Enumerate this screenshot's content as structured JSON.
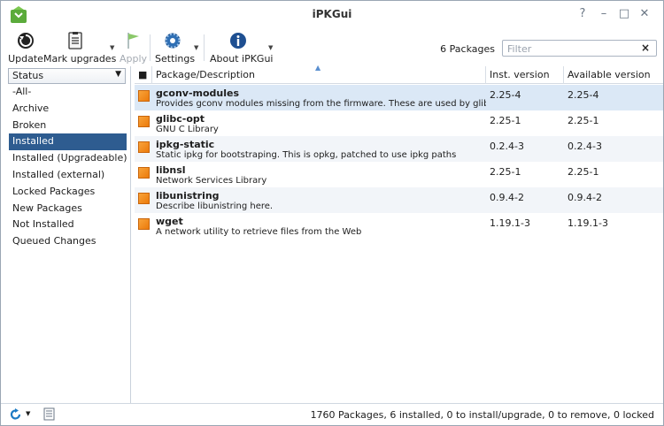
{
  "window": {
    "title": "iPKGui"
  },
  "toolbar": {
    "update_label": "Update",
    "mark_upgrades_label": "Mark upgrades",
    "apply_label": "Apply",
    "settings_label": "Settings",
    "about_label": "About iPKGui",
    "package_count": "6 Packages",
    "filter_placeholder": "Filter",
    "filter_clear": "×"
  },
  "sidebar": {
    "selector_value": "Status",
    "items": [
      {
        "label": "-All-"
      },
      {
        "label": "Archive"
      },
      {
        "label": "Broken"
      },
      {
        "label": "Installed",
        "selected": true
      },
      {
        "label": "Installed (Upgradeable)"
      },
      {
        "label": "Installed (external)"
      },
      {
        "label": "Locked Packages"
      },
      {
        "label": "New Packages"
      },
      {
        "label": "Not Installed"
      },
      {
        "label": "Queued Changes"
      }
    ]
  },
  "table": {
    "columns": [
      "Package/Description",
      "Inst. version",
      "Available version"
    ],
    "rows": [
      {
        "name": "gconv-modules",
        "desc": "Provides gconv modules missing from the firmware. These are used by glibc ico",
        "inst": "2.25-4",
        "avail": "2.25-4"
      },
      {
        "name": "glibc-opt",
        "desc": "GNU C Library",
        "inst": "2.25-1",
        "avail": "2.25-1"
      },
      {
        "name": "ipkg-static",
        "desc": "Static ipkg for bootstraping. This is opkg, patched to use ipkg paths",
        "inst": "0.2.4-3",
        "avail": "0.2.4-3"
      },
      {
        "name": "libnsl",
        "desc": "Network Services Library",
        "inst": "2.25-1",
        "avail": "2.25-1"
      },
      {
        "name": "libunistring",
        "desc": "Describe libunistring here.",
        "inst": "0.9.4-2",
        "avail": "0.9.4-2"
      },
      {
        "name": "wget",
        "desc": "A network utility to retrieve files from the Web",
        "inst": "1.19.1-3",
        "avail": "1.19.1-3"
      }
    ]
  },
  "statusbar": {
    "summary": "1760 Packages, 6 installed, 0 to install/upgrade, 0 to remove, 0 locked"
  },
  "colors": {
    "selection": "#2e5c90",
    "row_selected": "#dbe8f6",
    "package_icon": "#f39022"
  },
  "icons": [
    "app-icon",
    "update-icon",
    "mark-upgrades-icon",
    "apply-flag-icon",
    "settings-gear-icon",
    "about-info-icon",
    "refresh-icon",
    "log-icon",
    "package-icon"
  ]
}
